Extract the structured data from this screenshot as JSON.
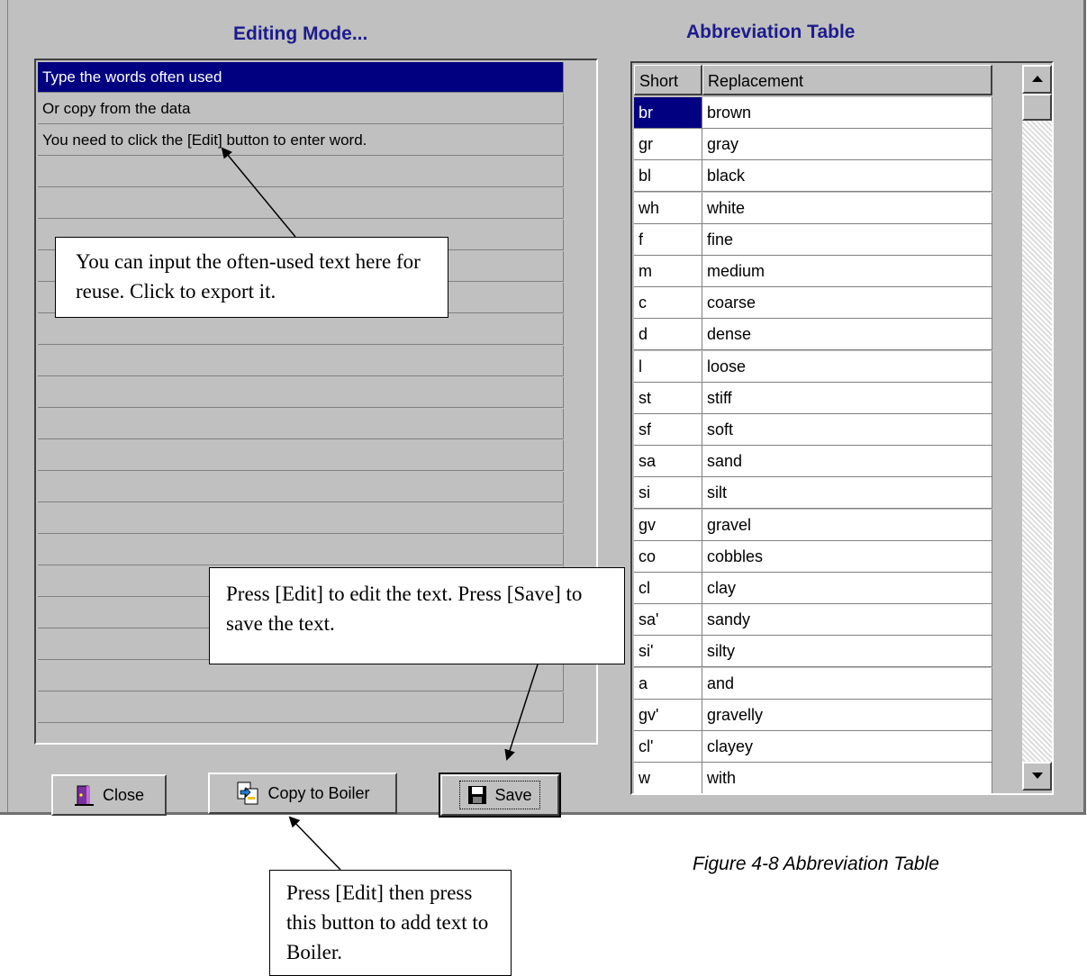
{
  "editing_title": "Editing Mode...",
  "abbr_title": "Abbreviation Table",
  "list_rows": [
    "Type the words often used",
    "Or copy from the data",
    "You need to click the [Edit] button to enter word.",
    "",
    "",
    "",
    "",
    "",
    "",
    "",
    "",
    "",
    "",
    "",
    "",
    "",
    "",
    "",
    "",
    "",
    ""
  ],
  "table": {
    "headers": [
      "Short",
      "Replacement"
    ],
    "rows": [
      [
        "br",
        "brown"
      ],
      [
        "gr",
        "gray"
      ],
      [
        "bl",
        "black"
      ],
      [
        "wh",
        "white"
      ],
      [
        "f",
        "fine"
      ],
      [
        "m",
        "medium"
      ],
      [
        "c",
        "coarse"
      ],
      [
        "d",
        "dense"
      ],
      [
        "l",
        "loose"
      ],
      [
        "st",
        "stiff"
      ],
      [
        "sf",
        "soft"
      ],
      [
        "sa",
        "sand"
      ],
      [
        "si",
        "silt"
      ],
      [
        "gv",
        "gravel"
      ],
      [
        "co",
        "cobbles"
      ],
      [
        "cl",
        "clay"
      ],
      [
        "sa'",
        "sandy"
      ],
      [
        "si'",
        "silty"
      ],
      [
        "a",
        "and"
      ],
      [
        "gv'",
        "gravelly"
      ],
      [
        "cl'",
        "clayey"
      ],
      [
        "w",
        "with"
      ]
    ]
  },
  "buttons": {
    "close": "Close",
    "copy": "Copy to Boiler",
    "save": "Save"
  },
  "callouts": {
    "list": "You can input the often-used text here for reuse. Click to export it.",
    "edit": "Press [Edit] to edit the text. Press [Save] to save the text.",
    "boiler": "Press [Edit] then press this button to add text to Boiler."
  },
  "caption": "Figure 4-8 Abbreviation Table"
}
